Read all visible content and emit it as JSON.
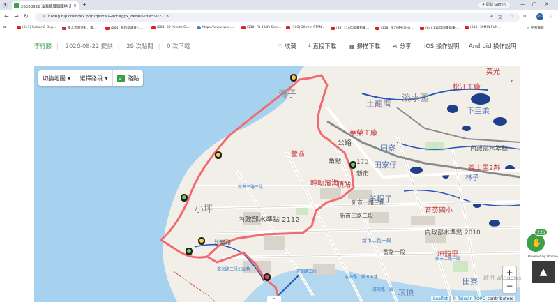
{
  "browser": {
    "tab_title": "20260822 淡海龍鳳頭陣地 海岸",
    "tab_close": "×",
    "new_tab": "+",
    "gemini_label": "✦ 問問 Gemini",
    "url": "hiking.biji.co/index.php?q=trail&act=gpx_detail&id=5902218",
    "avatar_text": "NTU",
    "controls": {
      "minimize": "—",
      "maximize": "▢",
      "close": "✕"
    }
  },
  "bookmarks": [
    {
      "label": "(347) Senior & Beg...",
      "icon": "youtube"
    },
    {
      "label": "臺北市南京幹：臺...",
      "icon": "red"
    },
    {
      "label": "(264) 我們愛讀書｜...",
      "icon": "youtube"
    },
    {
      "label": "(284) 30 Minute St...",
      "icon": "youtube"
    },
    {
      "label": "https://www.twse....",
      "icon": "globe"
    },
    {
      "label": "(110) Fit 4 Life Seni...",
      "icon": "youtube"
    },
    {
      "label": "(103) 20 min STAN...",
      "icon": "youtube"
    },
    {
      "label": "(84) 110年國畫鉛筆...",
      "icon": "youtube"
    },
    {
      "label": "(158) 深刀健身SHO...",
      "icon": "youtube"
    },
    {
      "label": "(84) 110年國畫鉛筆-...",
      "icon": "youtube"
    },
    {
      "label": "(311) 30MIN FUN...",
      "icon": "youtube"
    }
  ],
  "bookmarks_all": "所有書籤",
  "trail": {
    "author": "李得勝",
    "date": "2026-08-22 提供",
    "views": "29 次點閱",
    "downloads": "0 次下載",
    "actions": [
      {
        "label": "收藏",
        "icon": "heart-icon"
      },
      {
        "label": "直接下載",
        "icon": "download-icon"
      },
      {
        "label": "掃描下載",
        "icon": "qr-icon"
      },
      {
        "label": "分享",
        "icon": "share-icon"
      },
      {
        "label": "iOS 操作說明",
        "icon": ""
      },
      {
        "label": "Android 操作說明",
        "icon": ""
      }
    ]
  },
  "map": {
    "switch_map": "切換地圖",
    "select_route": "選擇路段",
    "waypoints_label": "路點",
    "zoom_in": "+",
    "zoom_out": "−",
    "expand_up": "⌃",
    "attribution": {
      "prefix": "Leaflet",
      "sep": " | © ",
      "link": "Taiwan TOPO",
      "suffix": " contributors"
    },
    "colors": {
      "sea": "#a7d2ef",
      "route": "#f06a70",
      "land": "#f2efe9"
    },
    "labels": [
      {
        "text": "英光",
        "color": "#c0353a"
      },
      {
        "text": "松江工廠",
        "color": "#c0353a"
      },
      {
        "text": "海子",
        "color": "#8f8f8f"
      },
      {
        "text": "土龍厝",
        "color": "#7a7a9a"
      },
      {
        "text": "淡水區",
        "color": "#8a8a8a"
      },
      {
        "text": "下圭柔",
        "color": "#5d7db6"
      },
      {
        "text": "華榮工廠",
        "color": "#c0353a"
      },
      {
        "text": "公路",
        "color": "#555555"
      },
      {
        "text": "田寮",
        "color": "#5d7db6"
      },
      {
        "text": "內政部水準點",
        "color": "#555555"
      },
      {
        "text": "營區",
        "color": "#c0353a"
      },
      {
        "text": "角點",
        "color": "#555555"
      },
      {
        "text": "170",
        "color": "#555555"
      },
      {
        "text": "新市",
        "color": "#555555"
      },
      {
        "text": "田寮仔",
        "color": "#5d7db6"
      },
      {
        "text": "義山里2鄰",
        "color": "#c0353a"
      },
      {
        "text": "林子",
        "color": "#5d7db6"
      },
      {
        "text": "輕軌濱海",
        "color": "#c0353a"
      },
      {
        "text": "頂站",
        "color": "#c0353a"
      },
      {
        "text": "新市三路三段",
        "color": "#3d7ac7"
      },
      {
        "text": "羊稠子",
        "color": "#5d7db6"
      },
      {
        "text": "小坪",
        "color": "#8a8a8a"
      },
      {
        "text": "新市一路三段",
        "color": "#555555"
      },
      {
        "text": "育英國小",
        "color": "#c0353a"
      },
      {
        "text": "內政部水準點 2112",
        "color": "#555555"
      },
      {
        "text": "新市三路二段",
        "color": "#555555"
      },
      {
        "text": "內政部水準點 2010",
        "color": "#555555"
      },
      {
        "text": "新市二路一段",
        "color": "#3d7ac7"
      },
      {
        "text": "沙崙路",
        "color": "#555555"
      },
      {
        "text": "番路一段",
        "color": "#555555"
      },
      {
        "text": "坤頭里",
        "color": "#c0353a"
      },
      {
        "text": "濱海路二段202巷",
        "color": "#3d7ac7"
      },
      {
        "text": "濱海路三段",
        "color": "#3d7ac7"
      },
      {
        "text": "濱海路二段306巷",
        "color": "#3d7ac7"
      },
      {
        "text": "濱海路一段",
        "color": "#3d7ac7"
      },
      {
        "text": "崁頂",
        "color": "#5d7db6"
      },
      {
        "text": "田寮",
        "color": "#5d7db6"
      },
      {
        "text": "新市二路一段",
        "color": "#3d7ac7"
      }
    ]
  },
  "side": {
    "badge_count": "236",
    "powered": "Powered by Proficio",
    "scroll_top": "▲",
    "watermark": "啟用 Windows"
  }
}
